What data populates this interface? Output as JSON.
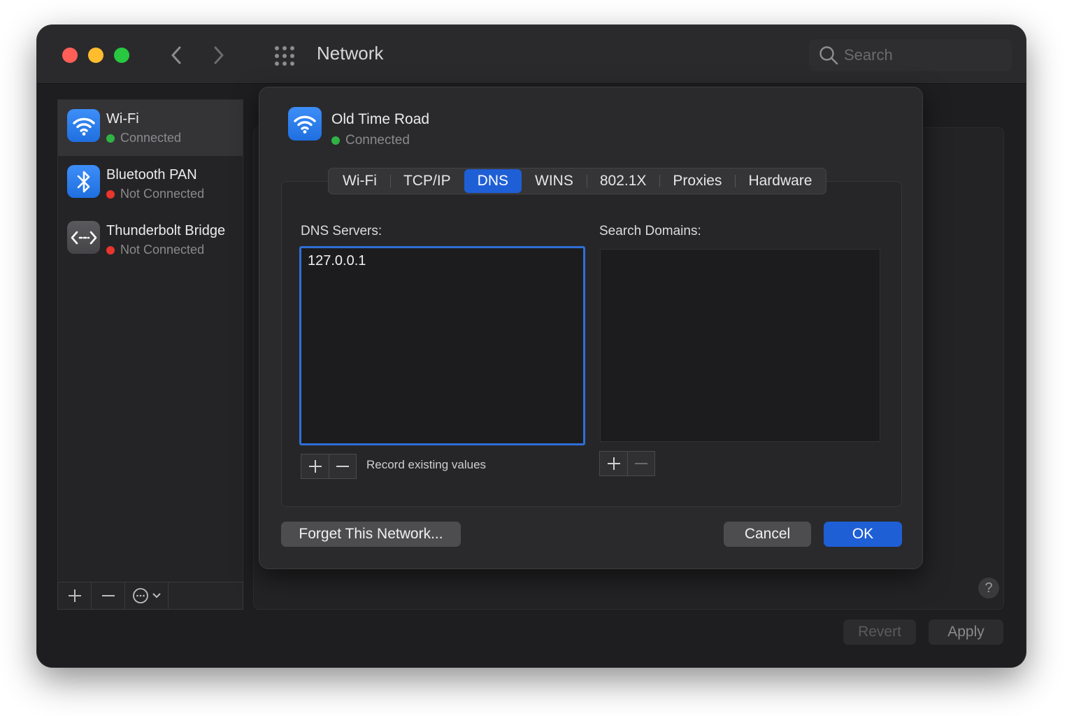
{
  "window": {
    "title": "Network",
    "search_placeholder": "Search"
  },
  "sidebar": {
    "services": [
      {
        "name": "Wi-Fi",
        "status": "Connected",
        "status_color": "#2fb344",
        "icon": "wifi-icon"
      },
      {
        "name": "Bluetooth PAN",
        "status": "Not Connected",
        "status_color": "#e8352e",
        "icon": "bluetooth-icon"
      },
      {
        "name": "Thunderbolt Bridge",
        "status": "Not Connected",
        "status_color": "#e8352e",
        "icon": "thunderbolt-bridge-icon"
      }
    ]
  },
  "sheet": {
    "network_name": "Old Time Road",
    "network_status": "Connected",
    "tabs": [
      "Wi-Fi",
      "TCP/IP",
      "DNS",
      "WINS",
      "802.1X",
      "Proxies",
      "Hardware"
    ],
    "active_tab": "DNS",
    "dns_servers_label": "DNS Servers:",
    "dns_servers": [
      "127.0.0.1"
    ],
    "search_domains_label": "Search Domains:",
    "search_domains": [],
    "record_existing_label": "Record existing values",
    "forget_label": "Forget This Network...",
    "cancel_label": "Cancel",
    "ok_label": "OK"
  },
  "footer": {
    "help_label": "?",
    "revert_label": "Revert",
    "apply_label": "Apply"
  },
  "colors": {
    "accent": "#1f5fd6",
    "connected": "#2fb344",
    "not_connected": "#e8352e"
  }
}
